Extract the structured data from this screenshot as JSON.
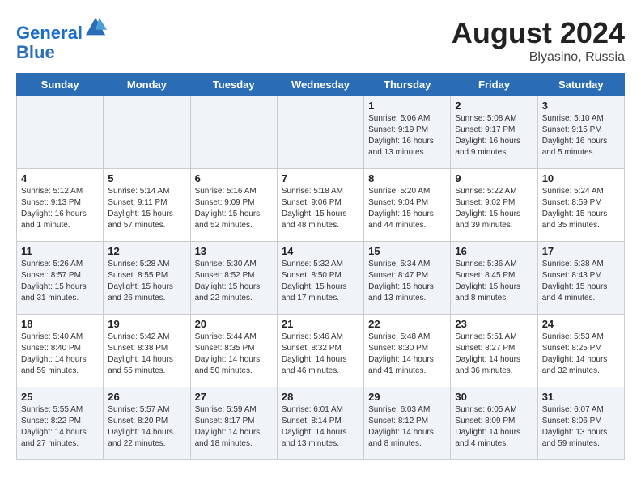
{
  "header": {
    "logo_line1": "General",
    "logo_line2": "Blue",
    "title": "August 2024",
    "subtitle": "Blyasino, Russia"
  },
  "weekdays": [
    "Sunday",
    "Monday",
    "Tuesday",
    "Wednesday",
    "Thursday",
    "Friday",
    "Saturday"
  ],
  "weeks": [
    [
      {
        "day": "",
        "info": ""
      },
      {
        "day": "",
        "info": ""
      },
      {
        "day": "",
        "info": ""
      },
      {
        "day": "",
        "info": ""
      },
      {
        "day": "1",
        "info": "Sunrise: 5:06 AM\nSunset: 9:19 PM\nDaylight: 16 hours\nand 13 minutes."
      },
      {
        "day": "2",
        "info": "Sunrise: 5:08 AM\nSunset: 9:17 PM\nDaylight: 16 hours\nand 9 minutes."
      },
      {
        "day": "3",
        "info": "Sunrise: 5:10 AM\nSunset: 9:15 PM\nDaylight: 16 hours\nand 5 minutes."
      }
    ],
    [
      {
        "day": "4",
        "info": "Sunrise: 5:12 AM\nSunset: 9:13 PM\nDaylight: 16 hours\nand 1 minute."
      },
      {
        "day": "5",
        "info": "Sunrise: 5:14 AM\nSunset: 9:11 PM\nDaylight: 15 hours\nand 57 minutes."
      },
      {
        "day": "6",
        "info": "Sunrise: 5:16 AM\nSunset: 9:09 PM\nDaylight: 15 hours\nand 52 minutes."
      },
      {
        "day": "7",
        "info": "Sunrise: 5:18 AM\nSunset: 9:06 PM\nDaylight: 15 hours\nand 48 minutes."
      },
      {
        "day": "8",
        "info": "Sunrise: 5:20 AM\nSunset: 9:04 PM\nDaylight: 15 hours\nand 44 minutes."
      },
      {
        "day": "9",
        "info": "Sunrise: 5:22 AM\nSunset: 9:02 PM\nDaylight: 15 hours\nand 39 minutes."
      },
      {
        "day": "10",
        "info": "Sunrise: 5:24 AM\nSunset: 8:59 PM\nDaylight: 15 hours\nand 35 minutes."
      }
    ],
    [
      {
        "day": "11",
        "info": "Sunrise: 5:26 AM\nSunset: 8:57 PM\nDaylight: 15 hours\nand 31 minutes."
      },
      {
        "day": "12",
        "info": "Sunrise: 5:28 AM\nSunset: 8:55 PM\nDaylight: 15 hours\nand 26 minutes."
      },
      {
        "day": "13",
        "info": "Sunrise: 5:30 AM\nSunset: 8:52 PM\nDaylight: 15 hours\nand 22 minutes."
      },
      {
        "day": "14",
        "info": "Sunrise: 5:32 AM\nSunset: 8:50 PM\nDaylight: 15 hours\nand 17 minutes."
      },
      {
        "day": "15",
        "info": "Sunrise: 5:34 AM\nSunset: 8:47 PM\nDaylight: 15 hours\nand 13 minutes."
      },
      {
        "day": "16",
        "info": "Sunrise: 5:36 AM\nSunset: 8:45 PM\nDaylight: 15 hours\nand 8 minutes."
      },
      {
        "day": "17",
        "info": "Sunrise: 5:38 AM\nSunset: 8:43 PM\nDaylight: 15 hours\nand 4 minutes."
      }
    ],
    [
      {
        "day": "18",
        "info": "Sunrise: 5:40 AM\nSunset: 8:40 PM\nDaylight: 14 hours\nand 59 minutes."
      },
      {
        "day": "19",
        "info": "Sunrise: 5:42 AM\nSunset: 8:38 PM\nDaylight: 14 hours\nand 55 minutes."
      },
      {
        "day": "20",
        "info": "Sunrise: 5:44 AM\nSunset: 8:35 PM\nDaylight: 14 hours\nand 50 minutes."
      },
      {
        "day": "21",
        "info": "Sunrise: 5:46 AM\nSunset: 8:32 PM\nDaylight: 14 hours\nand 46 minutes."
      },
      {
        "day": "22",
        "info": "Sunrise: 5:48 AM\nSunset: 8:30 PM\nDaylight: 14 hours\nand 41 minutes."
      },
      {
        "day": "23",
        "info": "Sunrise: 5:51 AM\nSunset: 8:27 PM\nDaylight: 14 hours\nand 36 minutes."
      },
      {
        "day": "24",
        "info": "Sunrise: 5:53 AM\nSunset: 8:25 PM\nDaylight: 14 hours\nand 32 minutes."
      }
    ],
    [
      {
        "day": "25",
        "info": "Sunrise: 5:55 AM\nSunset: 8:22 PM\nDaylight: 14 hours\nand 27 minutes."
      },
      {
        "day": "26",
        "info": "Sunrise: 5:57 AM\nSunset: 8:20 PM\nDaylight: 14 hours\nand 22 minutes."
      },
      {
        "day": "27",
        "info": "Sunrise: 5:59 AM\nSunset: 8:17 PM\nDaylight: 14 hours\nand 18 minutes."
      },
      {
        "day": "28",
        "info": "Sunrise: 6:01 AM\nSunset: 8:14 PM\nDaylight: 14 hours\nand 13 minutes."
      },
      {
        "day": "29",
        "info": "Sunrise: 6:03 AM\nSunset: 8:12 PM\nDaylight: 14 hours\nand 8 minutes."
      },
      {
        "day": "30",
        "info": "Sunrise: 6:05 AM\nSunset: 8:09 PM\nDaylight: 14 hours\nand 4 minutes."
      },
      {
        "day": "31",
        "info": "Sunrise: 6:07 AM\nSunset: 8:06 PM\nDaylight: 13 hours\nand 59 minutes."
      }
    ]
  ]
}
